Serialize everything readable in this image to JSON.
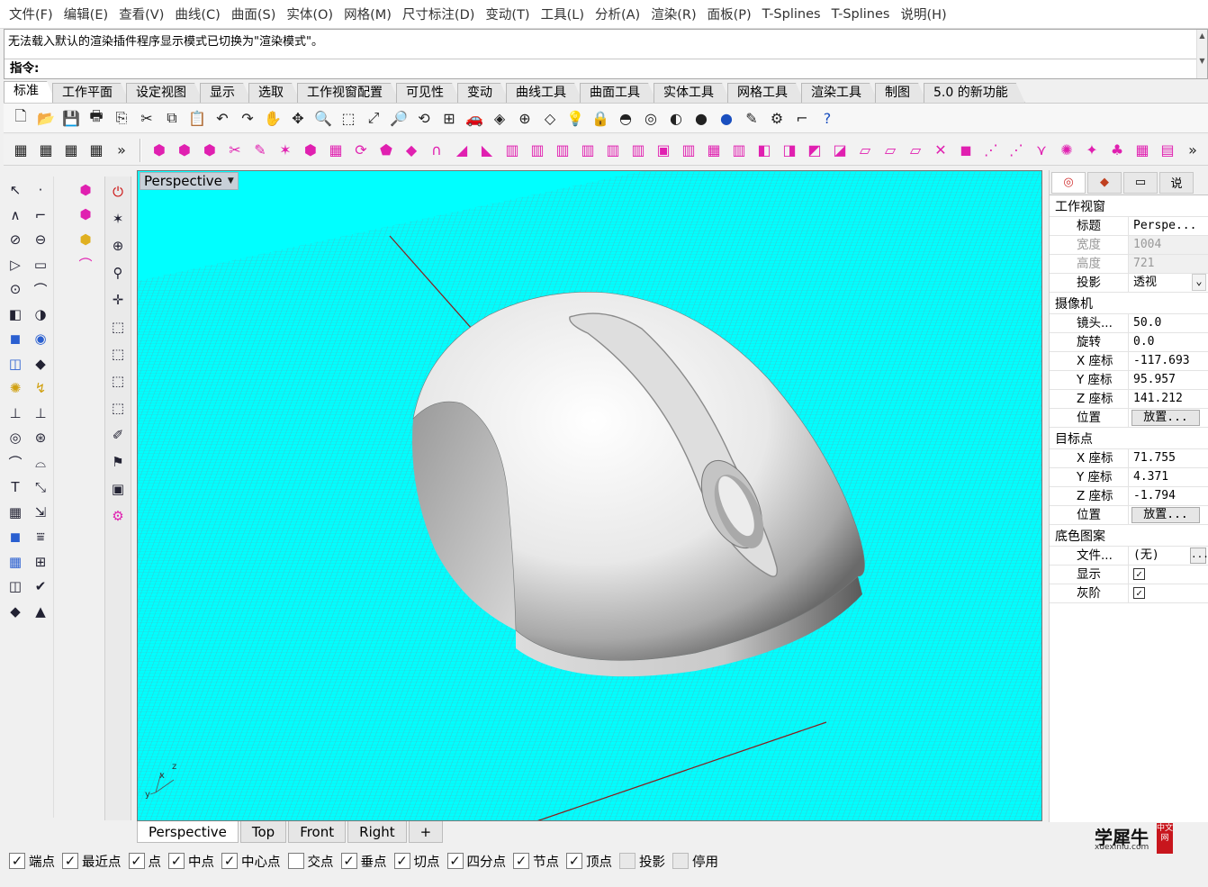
{
  "menu": [
    "文件(F)",
    "编辑(E)",
    "查看(V)",
    "曲线(C)",
    "曲面(S)",
    "实体(O)",
    "网格(M)",
    "尺寸标注(D)",
    "变动(T)",
    "工具(L)",
    "分析(A)",
    "渲染(R)",
    "面板(P)",
    "T-Splines",
    "T-Splines",
    "说明(H)"
  ],
  "command": {
    "history": "无法载入默认的渲染插件程序显示模式已切换为\"渲染模式\"。",
    "prompt": "指令:"
  },
  "toolbar_tabs": [
    "标准",
    "工作平面",
    "设定视图",
    "显示",
    "选取",
    "工作视窗配置",
    "可见性",
    "变动",
    "曲线工具",
    "曲面工具",
    "实体工具",
    "网格工具",
    "渲染工具",
    "制图",
    "5.0 的新功能"
  ],
  "viewport": {
    "title": "Perspective",
    "axis_labels": {
      "z": "z",
      "y": "y",
      "x": "x"
    }
  },
  "viewport_tabs": [
    "Perspective",
    "Top",
    "Front",
    "Right",
    "+"
  ],
  "properties": {
    "tabs": [
      "",
      "",
      "",
      "说"
    ],
    "sections": [
      {
        "title": "工作视窗",
        "rows": [
          {
            "k": "标题",
            "v": "Perspe..."
          },
          {
            "k": "宽度",
            "v": "1004",
            "dim": true
          },
          {
            "k": "高度",
            "v": "721",
            "dim": true
          },
          {
            "k": "投影",
            "v": "透视",
            "dropdown": true
          }
        ]
      },
      {
        "title": "摄像机",
        "rows": [
          {
            "k": "镜头...",
            "v": "50.0"
          },
          {
            "k": "旋转",
            "v": "0.0"
          },
          {
            "k": "X 座标",
            "v": "-117.693"
          },
          {
            "k": "Y 座标",
            "v": "95.957"
          },
          {
            "k": "Z 座标",
            "v": "141.212"
          },
          {
            "k": "位置",
            "v": "放置...",
            "button": true
          }
        ]
      },
      {
        "title": "目标点",
        "rows": [
          {
            "k": "X 座标",
            "v": "71.755"
          },
          {
            "k": "Y 座标",
            "v": "4.371"
          },
          {
            "k": "Z 座标",
            "v": "-1.794"
          },
          {
            "k": "位置",
            "v": "放置...",
            "button": true
          }
        ]
      },
      {
        "title": "底色图案",
        "rows": [
          {
            "k": "文件...",
            "v": "(无)",
            "more": "..."
          },
          {
            "k": "显示",
            "v": "",
            "checked": true
          },
          {
            "k": "灰阶",
            "v": "",
            "checked": true
          }
        ]
      }
    ]
  },
  "osnap": [
    {
      "label": "端点",
      "checked": true
    },
    {
      "label": "最近点",
      "checked": true
    },
    {
      "label": "点",
      "checked": true
    },
    {
      "label": "中点",
      "checked": true
    },
    {
      "label": "中心点",
      "checked": true
    },
    {
      "label": "交点",
      "checked": false
    },
    {
      "label": "垂点",
      "checked": true
    },
    {
      "label": "切点",
      "checked": true
    },
    {
      "label": "四分点",
      "checked": true
    },
    {
      "label": "节点",
      "checked": true
    },
    {
      "label": "顶点",
      "checked": true
    },
    {
      "label": "投影",
      "checked": false,
      "disabled": true
    },
    {
      "label": "停用",
      "checked": false,
      "disabled": true
    }
  ],
  "watermark": {
    "title": "学犀牛",
    "url": "xuexiniu.com",
    "badge": "中文网"
  },
  "colors": {
    "viewport_bg": "#00ffff",
    "grid_line": "#55b9c2",
    "accent_icon": "#e020b0",
    "x_axis": "#8b1c1c",
    "y_axis": "#1f6a1f"
  }
}
